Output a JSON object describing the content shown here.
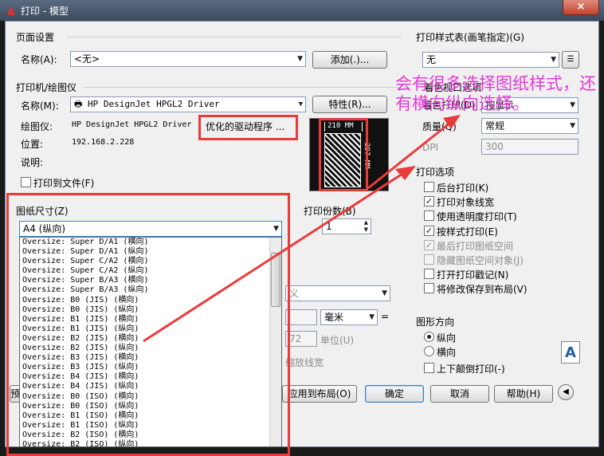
{
  "window": {
    "title": "打印 - 模型",
    "close_glyph": "×",
    "app_icon_glyph": "▲"
  },
  "page_setup": {
    "group_label": "页面设置",
    "name_label": "名称(A):",
    "name_value": "<无>",
    "add_button": "添加(.)..."
  },
  "printer": {
    "group_label": "打印机/绘图仪",
    "name_label": "名称(M):",
    "name_value": "HP DesignJet HPGL2 Driver",
    "properties_button": "特性(R)...",
    "plotter_label": "绘图仪:",
    "plotter_value": "HP DesignJet HPGL2 Driver",
    "driver_note": "优化的驱动程序 ...",
    "location_label": "位置:",
    "location_value": "192.168.2.228",
    "description_label": "说明:",
    "print_to_file": "打印到文件(F)"
  },
  "preview": {
    "width_label": "210 MM",
    "height_label": "297 MM"
  },
  "paper_size": {
    "group_label": "图纸尺寸(Z)",
    "selected": "A4 (纵向)",
    "items": [
      "Oversize: Super D/A1 (横向)",
      "Oversize: Super D/A1 (纵向)",
      "Oversize: Super C/A2 (横向)",
      "Oversize: Super C/A2 (纵向)",
      "Oversize: Super B/A3 (横向)",
      "Oversize: Super B/A3 (纵向)",
      "Oversize: B0 (JIS) (横向)",
      "Oversize: B0 (JIS) (纵向)",
      "Oversize: B1 (JIS) (横向)",
      "Oversize: B1 (JIS) (纵向)",
      "Oversize: B2 (JIS) (横向)",
      "Oversize: B2 (JIS) (纵向)",
      "Oversize: B3 (JIS) (横向)",
      "Oversize: B3 (JIS) (纵向)",
      "Oversize: B4 (JIS) (横向)",
      "Oversize: B4 (JIS) (纵向)",
      "Oversize: B0 (ISO) (横向)",
      "Oversize: B0 (ISO) (纵向)",
      "Oversize: B1 (ISO) (横向)",
      "Oversize: B1 (ISO) (纵向)",
      "Oversize: B2 (ISO) (横向)",
      "Oversize: B2 (ISO) (纵向)"
    ]
  },
  "copies": {
    "label": "打印份数(B)",
    "value": "1"
  },
  "obscured": {
    "scale_partial": "义",
    "unit_value": "毫米",
    "unit_trailing": "=",
    "scale_value": "72",
    "unit_label": "单位(U)",
    "lineweight_partial": "缩放线宽"
  },
  "style_table": {
    "group_label": "打印样式表(画笔指定)(G)",
    "value": "无",
    "shaded_group_partial": "着色视口选项",
    "shade_label": "着色打印(D)",
    "shade_value": "按显示",
    "quality_label": "质量(Q)",
    "quality_value": "常规",
    "dpi_label": "DPI",
    "dpi_value": "300"
  },
  "plot_options": {
    "group_label": "打印选项",
    "items": [
      {
        "label": "后台打印(K)",
        "checked": false,
        "enabled": true
      },
      {
        "label": "打印对象线宽",
        "checked": true,
        "enabled": true
      },
      {
        "label": "使用透明度打印(T)",
        "checked": false,
        "enabled": true
      },
      {
        "label": "按样式打印(E)",
        "checked": true,
        "enabled": true
      },
      {
        "label": "最后打印图纸空间",
        "checked": true,
        "enabled": false
      },
      {
        "label": "隐藏图纸空间对象(J)",
        "checked": false,
        "enabled": false
      },
      {
        "label": "打开打印戳记(N)",
        "checked": false,
        "enabled": true
      },
      {
        "label": "将修改保存到布局(V)",
        "checked": false,
        "enabled": true
      }
    ]
  },
  "orientation": {
    "group_label": "图形方向",
    "portrait": "纵向",
    "landscape": "横向",
    "upside_down": "上下颠倒打印(-)",
    "icon_letter": "A"
  },
  "footer": {
    "apply_button": "应用到布局(O)",
    "ok_button": "确定",
    "cancel_button": "取消",
    "help_button": "帮助(H)",
    "collapse_glyph": "◀",
    "preview_partial": "预"
  },
  "annotation": {
    "text": "会有很多选择图纸样式，还有横向纵向选择。"
  }
}
